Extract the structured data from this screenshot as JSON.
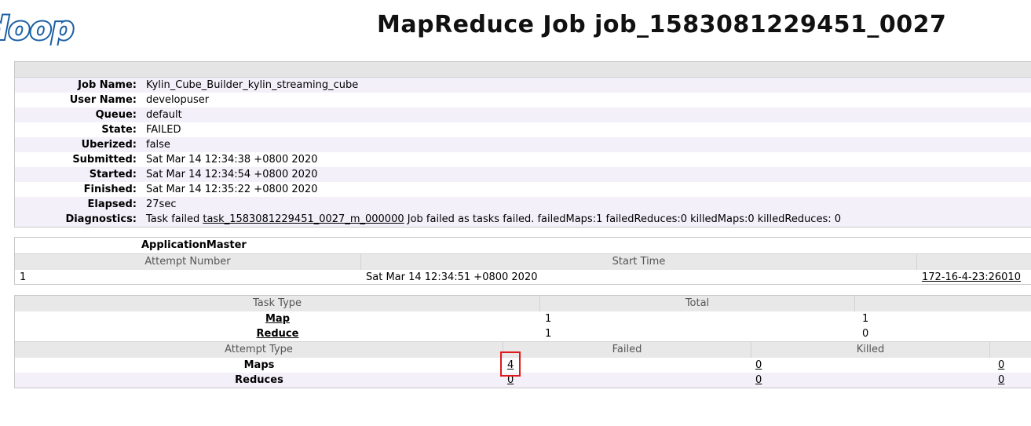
{
  "logo": {
    "text": "doop",
    "fill": "#ffffff",
    "stroke": "#1a5fa5"
  },
  "page_title": "MapReduce Job job_1583081229451_0027",
  "job_info": [
    {
      "label": "Job Name:",
      "value": "Kylin_Cube_Builder_kylin_streaming_cube"
    },
    {
      "label": "User Name:",
      "value": "developuser"
    },
    {
      "label": "Queue:",
      "value": "default"
    },
    {
      "label": "State:",
      "value": "FAILED"
    },
    {
      "label": "Uberized:",
      "value": "false"
    },
    {
      "label": "Submitted:",
      "value": "Sat Mar 14 12:34:38 +0800 2020"
    },
    {
      "label": "Started:",
      "value": "Sat Mar 14 12:34:54 +0800 2020"
    },
    {
      "label": "Finished:",
      "value": "Sat Mar 14 12:35:22 +0800 2020"
    },
    {
      "label": "Elapsed:",
      "value": "27sec"
    }
  ],
  "diagnostics": {
    "label": "Diagnostics:",
    "prefix": "Task failed ",
    "task_link": "task_1583081229451_0027_m_000000",
    "suffix": " Job failed as tasks failed. failedMaps:1 failedReduces:0 killedMaps:0 killedReduces: 0"
  },
  "application_master": {
    "title": "ApplicationMaster",
    "headers": [
      "Attempt Number",
      "Start Time",
      ""
    ],
    "row": {
      "attempt": "1",
      "start_time": "Sat Mar 14 12:34:51 +0800 2020",
      "node": "172-16-4-23:26010"
    }
  },
  "tasks": {
    "headers": [
      "Task Type",
      "Total",
      ""
    ],
    "rows": [
      {
        "type": "Map",
        "total": "1",
        "complete": "1"
      },
      {
        "type": "Reduce",
        "total": "1",
        "complete": "0"
      }
    ]
  },
  "attempts": {
    "headers": [
      "Attempt Type",
      "",
      "Failed",
      "Killed",
      ""
    ],
    "rows": [
      {
        "type": "Maps",
        "failed": "4",
        "killed": "0",
        "successful": "0"
      },
      {
        "type": "Reduces",
        "failed": "0",
        "killed": "0",
        "successful": "0"
      }
    ]
  },
  "colors": {
    "highlight": "#e01a1a",
    "stripe": "#f3f0fa",
    "header": "#e8e8e8"
  }
}
